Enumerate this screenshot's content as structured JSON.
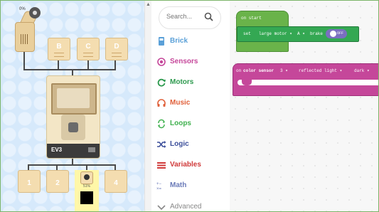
{
  "simulator": {
    "motor_dial_label": "0%",
    "motor_ports": [
      "B",
      "C",
      "D"
    ],
    "sensor_ports": [
      "1",
      "2",
      "4"
    ],
    "brick_label": "EV3",
    "color_sensor_value": "51%",
    "colors": {
      "background": "#d6e9fb",
      "brick": "#f3e6c6",
      "sensor_tile": "#f4ddb0",
      "sensor_highlight": "#fff7a8"
    }
  },
  "toolbox": {
    "search_placeholder": "Search...",
    "categories": [
      {
        "label": "Brick",
        "icon": "brick-icon",
        "color": "#5aa0d8"
      },
      {
        "label": "Sensors",
        "icon": "sensor-icon",
        "color": "#c5479a"
      },
      {
        "label": "Motors",
        "icon": "motor-icon",
        "color": "#2e9a4f"
      },
      {
        "label": "Music",
        "icon": "headphones-icon",
        "color": "#e0603a"
      },
      {
        "label": "Loops",
        "icon": "loop-icon",
        "color": "#3fb04e"
      },
      {
        "label": "Logic",
        "icon": "shuffle-icon",
        "color": "#3b4e9a"
      },
      {
        "label": "Variables",
        "icon": "list-icon",
        "color": "#d03a3a"
      },
      {
        "label": "Math",
        "icon": "math-icon",
        "color": "#6a7ab8"
      },
      {
        "label": "Advanced",
        "icon": "chevron-down-icon",
        "color": "#888888"
      }
    ]
  },
  "workspace": {
    "on_start_block": {
      "label": "on start",
      "set_label": "set",
      "motor_dropdown": "large motor ▾",
      "port_dropdown": "A ▾",
      "brake_label": "brake",
      "toggle_label": "OFF",
      "colors": {
        "hat": "#6ab34a",
        "set": "#34a853",
        "toggle": "#7a6fc0"
      }
    },
    "event_block": {
      "on_label": "on",
      "sensor_label": "color sensor",
      "port_dropdown": "3 ▾",
      "mode_dropdown": "reflected light ▾",
      "state_dropdown": "dark ▾",
      "color": "#c5479a"
    }
  }
}
